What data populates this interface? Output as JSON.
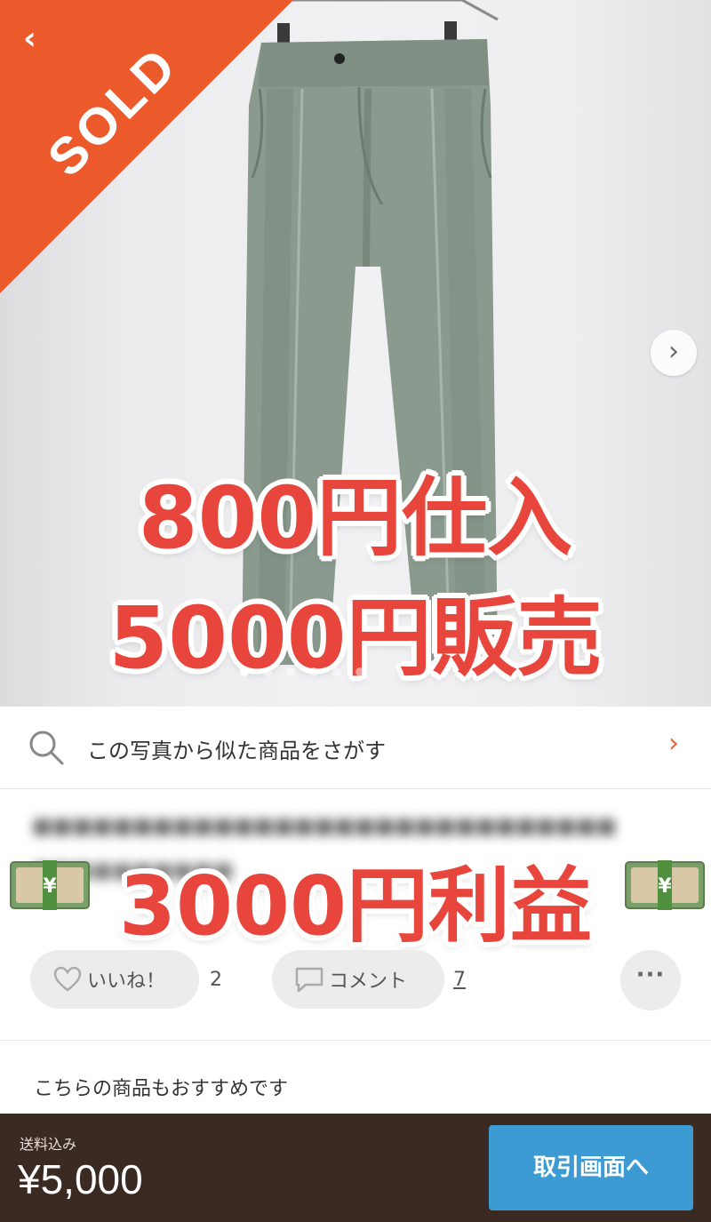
{
  "hero": {
    "sold_label": "SOLD",
    "back_icon": "chevron-left-icon",
    "next_icon": "chevron-right-icon",
    "overlay_line1": "800円仕入",
    "overlay_line2": "5000円販売",
    "carousel_dots": 6,
    "carousel_active_index": 0,
    "sold_color": "#ec5a2c",
    "overlay_color": "#e8453c"
  },
  "similar_search": {
    "label": "この写真から似た商品をさがす",
    "icon": "search-icon",
    "chevron_icon": "chevron-right-icon"
  },
  "item": {
    "profit_overlay": "3000円利益"
  },
  "actions": {
    "like_label": "いいね！",
    "like_count": "2",
    "comment_label": "コメント",
    "comment_count": "7",
    "more_label": "···"
  },
  "recommend": {
    "heading": "こちらの商品もおすすめです"
  },
  "bottom_bar": {
    "shipping_note": "送料込み",
    "price": "¥5,000",
    "buy_button": "取引画面へ",
    "bar_color": "#3a2a22",
    "button_color": "#3b9bd2"
  }
}
